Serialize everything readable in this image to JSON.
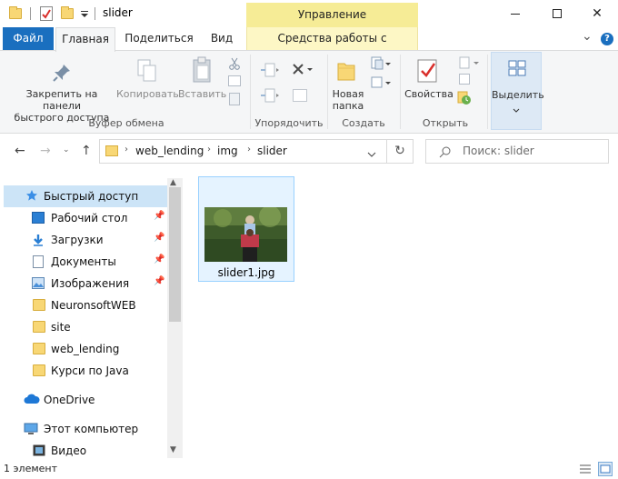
{
  "window": {
    "title": "slider",
    "contextual_band": "Управление",
    "controls": {
      "minimize": "minimize",
      "maximize": "maximize",
      "close": "✕"
    }
  },
  "tabs": {
    "file": "Файл",
    "home": "Главная",
    "share": "Поделиться",
    "view": "Вид",
    "picture_tools": "Средства работы с рисунками",
    "collapse": "⌄",
    "help": "?"
  },
  "ribbon": {
    "pin": "Закрепить на панели быстрого доступа",
    "pin_line1": "Закрепить на панели",
    "pin_line2": "быстрого доступа",
    "copy": "Копировать",
    "paste": "Вставить",
    "clipboard_group": "Буфер обмена",
    "organize_group": "Упорядочить",
    "new_folder_line1": "Новая",
    "new_folder_line2": "папка",
    "create_group": "Создать",
    "properties": "Свойства",
    "open_group": "Открыть",
    "select": "Выделить"
  },
  "address": {
    "crumbs": [
      "web_lending",
      "img",
      "slider"
    ],
    "search_placeholder": "Поиск: slider"
  },
  "nav": {
    "items": [
      {
        "label": "Быстрый доступ",
        "icon": "star-icon",
        "pinned": false,
        "selected": true
      },
      {
        "label": "Рабочий стол",
        "icon": "desktop-icon",
        "pinned": true
      },
      {
        "label": "Загрузки",
        "icon": "download-icon",
        "pinned": true
      },
      {
        "label": "Документы",
        "icon": "document-icon",
        "pinned": true
      },
      {
        "label": "Изображения",
        "icon": "pictures-icon",
        "pinned": true
      },
      {
        "label": "NeuronsoftWEB",
        "icon": "folder-icon",
        "pinned": false
      },
      {
        "label": "site",
        "icon": "folder-icon",
        "pinned": false
      },
      {
        "label": "web_lending",
        "icon": "folder-icon",
        "pinned": false
      },
      {
        "label": "Курси по Java",
        "icon": "folder-icon",
        "pinned": false
      },
      {
        "label": "OneDrive",
        "icon": "cloud-icon",
        "pinned": false
      },
      {
        "label": "Этот компьютер",
        "icon": "computer-icon",
        "pinned": false
      },
      {
        "label": "Видео",
        "icon": "video-icon",
        "pinned": false
      }
    ]
  },
  "files": [
    {
      "name": "slider1.jpg",
      "type": "image"
    }
  ],
  "status": {
    "count": "1 элемент"
  },
  "colors": {
    "accent": "#1a6fbf",
    "contextual": "#f6ec96",
    "selection": "#cce4f7",
    "folder": "#f8d775"
  }
}
